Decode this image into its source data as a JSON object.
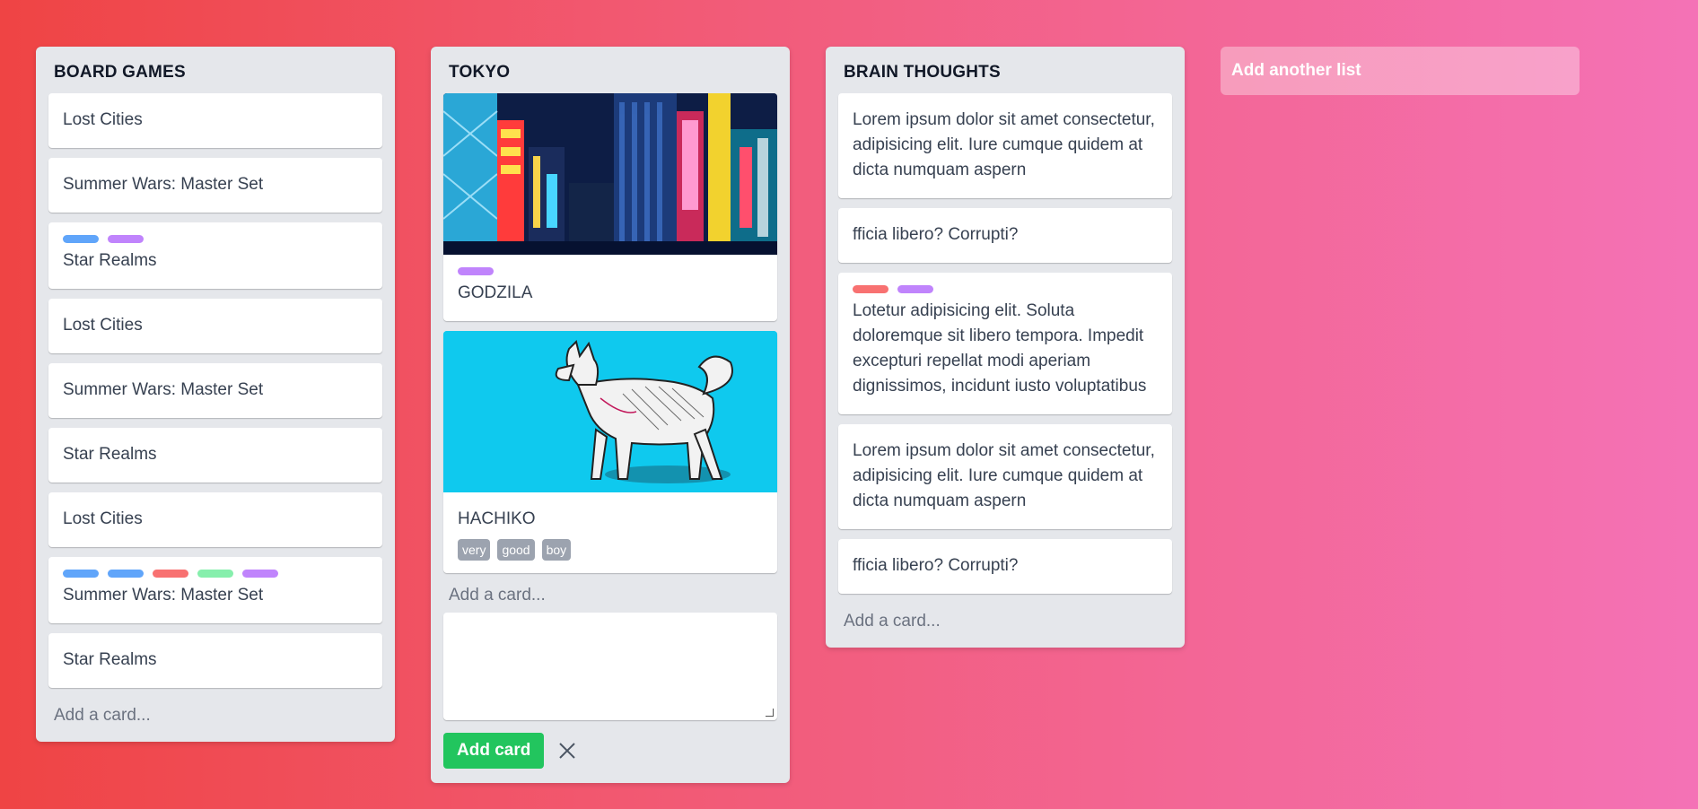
{
  "colors": {
    "label_blue": "#60a5fa",
    "label_purple": "#c084fc",
    "label_red": "#f87171",
    "label_green": "#86efac",
    "add_button_green": "#22c55e"
  },
  "lists": [
    {
      "title": "BOARD GAMES",
      "cards": [
        {
          "text": "Lost Cities"
        },
        {
          "text": "Summer Wars: Master Set"
        },
        {
          "text": "Star Realms",
          "labels": [
            "blue",
            "purple"
          ]
        },
        {
          "text": "Lost Cities"
        },
        {
          "text": "Summer Wars: Master Set"
        },
        {
          "text": "Star Realms"
        },
        {
          "text": "Lost Cities"
        },
        {
          "text": "Summer Wars: Master Set",
          "labels": [
            "blue",
            "blue",
            "red",
            "green",
            "purple"
          ]
        },
        {
          "text": "Star Realms"
        }
      ],
      "add_card": "Add a card..."
    },
    {
      "title": "TOKYO",
      "cards": [
        {
          "text": "GODZILA",
          "image": "tokyo-night-city-image",
          "labels": [
            "purple"
          ]
        },
        {
          "text": "HACHIKO",
          "image": "akita-dog-sketch-image",
          "tags": [
            "very",
            "good",
            "boy"
          ]
        }
      ],
      "add_card": "Add a card...",
      "composer": {
        "button": "Add card",
        "close_icon": "close-icon"
      }
    },
    {
      "title": "BRAIN THOUGHTS",
      "cards": [
        {
          "text": "Lorem ipsum dolor sit amet consectetur, adipisicing elit. Iure cumque quidem at dicta numquam aspern"
        },
        {
          "text": "fficia libero? Corrupti?"
        },
        {
          "text": "Lotetur adipisicing elit. Soluta doloremque sit libero tempora. Impedit excepturi repellat modi aperiam dignissimos, incidunt iusto voluptatibus",
          "labels": [
            "red",
            "purple"
          ]
        },
        {
          "text": "Lorem ipsum dolor sit amet consectetur, adipisicing elit. Iure cumque quidem at dicta numquam aspern"
        },
        {
          "text": "fficia libero? Corrupti?"
        }
      ],
      "add_card": "Add a card..."
    }
  ],
  "add_list": "Add another list"
}
